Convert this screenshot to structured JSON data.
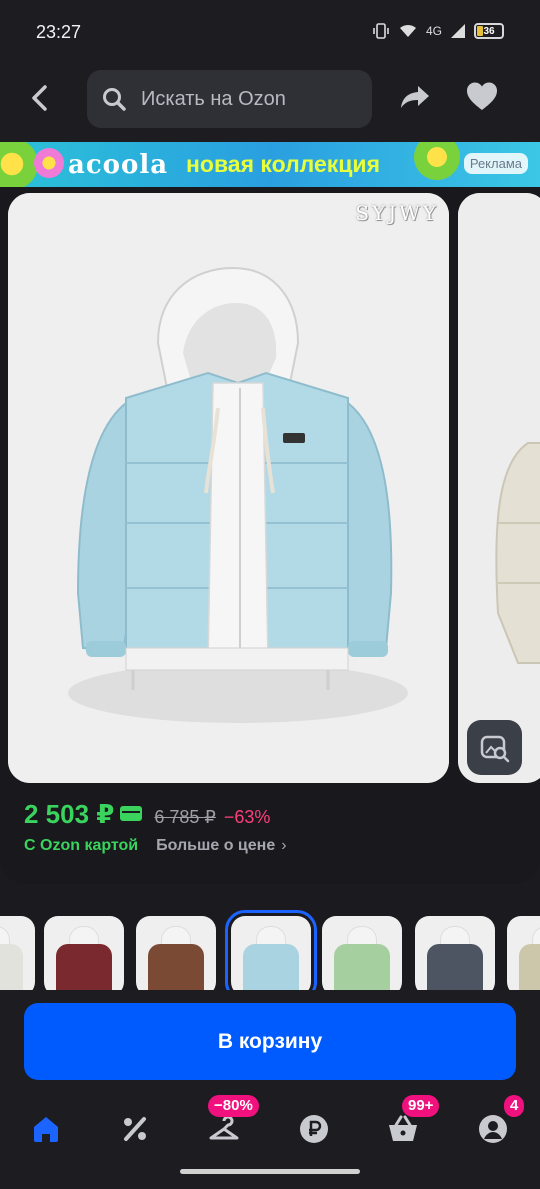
{
  "status_bar": {
    "time": "23:27",
    "network": "4G",
    "battery": "36"
  },
  "header": {
    "search_placeholder": "Искать на Ozon"
  },
  "banner": {
    "brand": "acoola",
    "text": "новая коллекция",
    "ad_label": "Реклама"
  },
  "product": {
    "photo_brand": "SYJWY",
    "price": "2 503 ₽",
    "old_price": "6 785 ₽",
    "discount": "−63%",
    "card_label": "С Ozon картой",
    "more_price": "Больше о цене"
  },
  "thumbnails": [
    {
      "color": "#e2e2dc"
    },
    {
      "color": "#7a2a2e"
    },
    {
      "color": "#7a4a35"
    },
    {
      "color": "#a9d3e0",
      "active": true
    },
    {
      "color": "#a6cf9f"
    },
    {
      "color": "#4d5563"
    },
    {
      "color": "#ccc6ab"
    }
  ],
  "cart_button": {
    "label": "В корзину"
  },
  "tabbar": {
    "badges": {
      "sale": "−80%",
      "cart": "99+",
      "profile": "4"
    }
  },
  "colors": {
    "accent": "#005bff",
    "price_green": "#3ad35d",
    "discount_pink": "#ff3f7a",
    "badge_pink": "#f1117e"
  }
}
